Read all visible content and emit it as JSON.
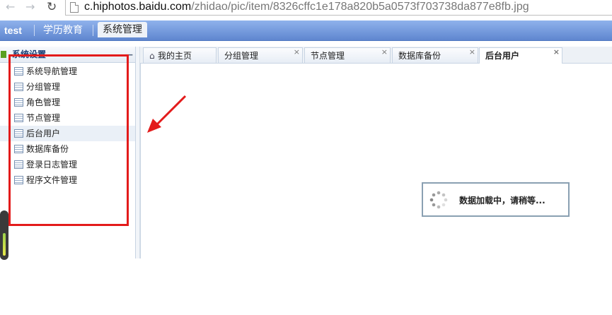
{
  "browser": {
    "url_host": "c.hiphotos.baidu.com",
    "url_path": "/zhidao/pic/item/8326cffc1e178a820b5a0573f703738da877e8fb.jpg"
  },
  "header": {
    "brand": "test",
    "nav": [
      "学历教育",
      "系统管理"
    ]
  },
  "sidebar": {
    "title": "系统设置",
    "items": [
      {
        "label": "系统导航管理"
      },
      {
        "label": "分组管理"
      },
      {
        "label": "角色管理"
      },
      {
        "label": "节点管理"
      },
      {
        "label": "后台用户"
      },
      {
        "label": "数据库备份"
      },
      {
        "label": "登录日志管理"
      },
      {
        "label": "程序文件管理"
      }
    ]
  },
  "tabs": [
    {
      "label": "我的主页"
    },
    {
      "label": "分组管理"
    },
    {
      "label": "节点管理"
    },
    {
      "label": "数据库备份"
    },
    {
      "label": "后台用户"
    }
  ],
  "loading": {
    "text": "数据加载中，请稍等..."
  },
  "colors": {
    "header_bg": "#6e93d8",
    "annotation_red": "#e31b1b",
    "accent_text": "#1a3d74"
  }
}
